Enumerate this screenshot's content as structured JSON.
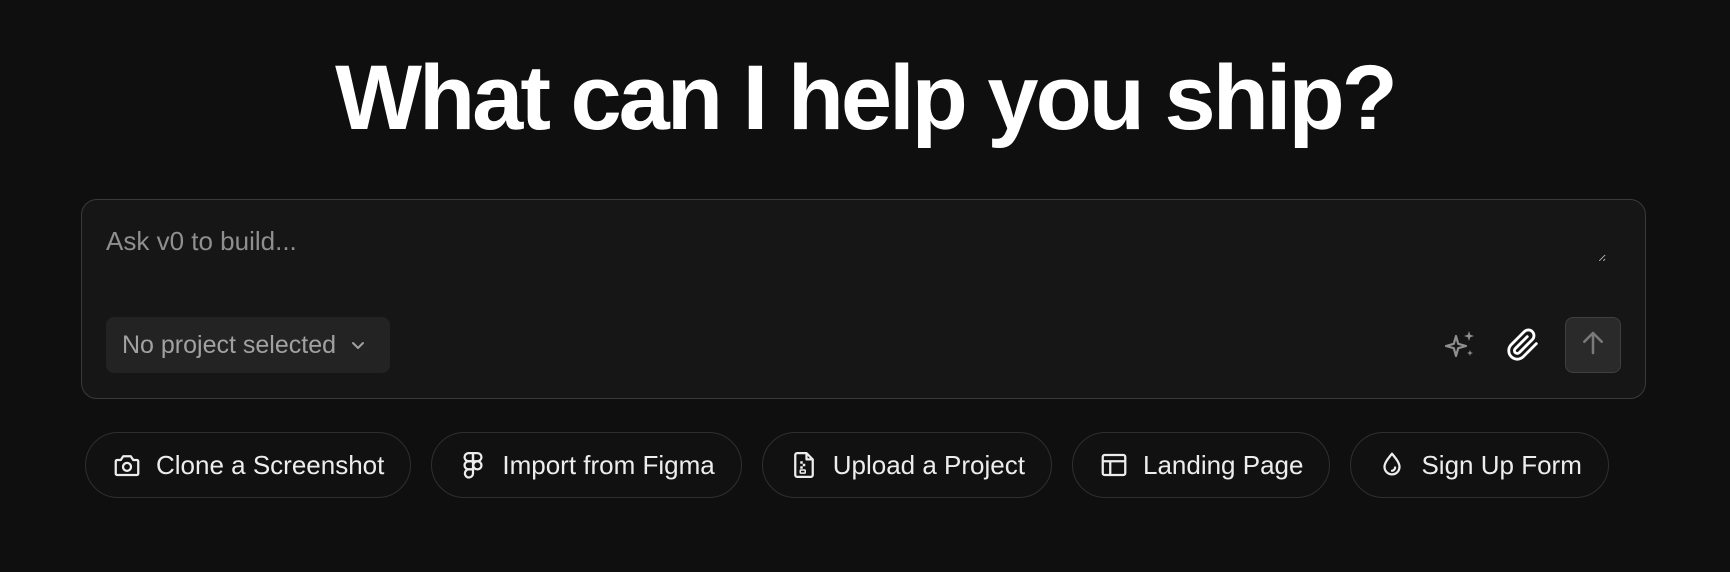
{
  "headline": "What can I help you ship?",
  "composer": {
    "placeholder": "Ask v0 to build...",
    "value": "",
    "project_select": {
      "label": "No project selected",
      "icon": "chevron-down-icon"
    },
    "tools": [
      {
        "name": "sparkles-icon"
      },
      {
        "name": "paperclip-icon"
      },
      {
        "name": "arrow-up-icon"
      }
    ]
  },
  "suggestions": [
    {
      "label": "Clone a Screenshot",
      "icon": "camera-icon"
    },
    {
      "label": "Import from Figma",
      "icon": "figma-icon"
    },
    {
      "label": "Upload a Project",
      "icon": "file-zip-icon"
    },
    {
      "label": "Landing Page",
      "icon": "layout-icon"
    },
    {
      "label": "Sign Up Form",
      "icon": "droplet-icon"
    }
  ],
  "colors": {
    "background": "#0f0f0f",
    "composer_bg": "#161616",
    "border": "#3a3a3a",
    "text_primary": "#ededed",
    "text_muted": "#8f8f8f"
  }
}
